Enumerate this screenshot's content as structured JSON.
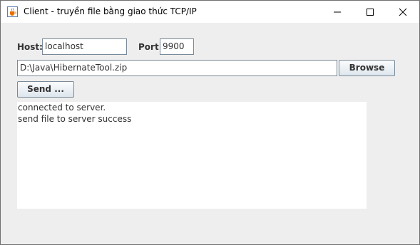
{
  "window": {
    "title": "Client - truyền file bằng giao thức TCP/IP"
  },
  "form": {
    "host_label": "Host:",
    "host_value": "localhost",
    "port_label": "Port:",
    "port_value": "9900",
    "file_path": "D:\\Java\\HibernateTool.zip",
    "browse_label": "Browse",
    "send_label": "Send ..."
  },
  "log": {
    "lines": [
      "connected to server.",
      "send file to server success"
    ]
  },
  "colors": {
    "window_bg": "#eeeeee",
    "titlebar_bg": "#ffffff",
    "text": "#333333"
  },
  "icons": [
    "java-cup-icon",
    "minimize-icon",
    "maximize-icon",
    "close-icon"
  ]
}
